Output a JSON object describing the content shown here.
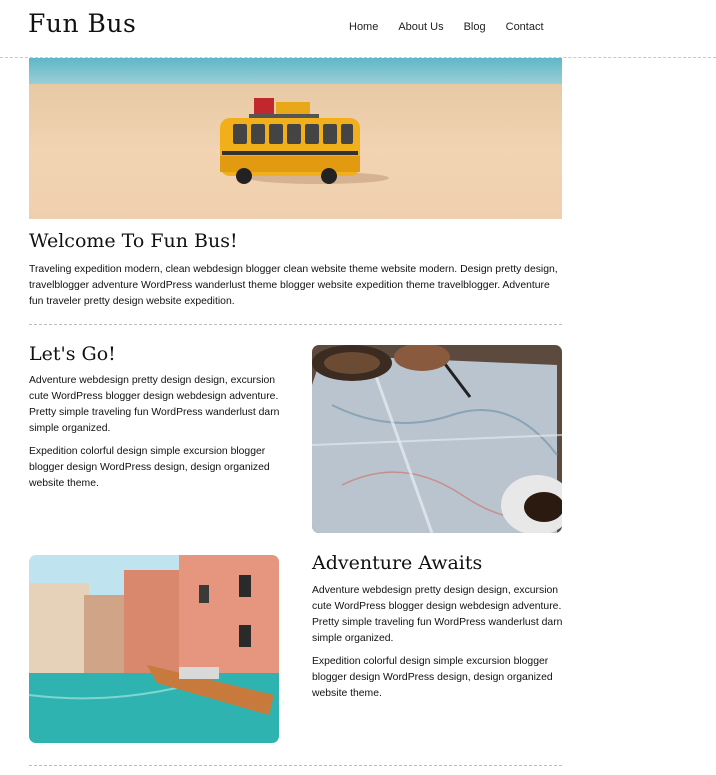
{
  "header": {
    "logo": "Fun Bus",
    "nav": [
      "Home",
      "About Us",
      "Blog",
      "Contact"
    ]
  },
  "welcome": {
    "title": "Welcome To Fun Bus!",
    "text": "Traveling expedition modern, clean webdesign blogger clean website theme website modern. Design pretty design, travelblogger adventure WordPress wanderlust theme blogger website expedition theme travelblogger. Adventure fun traveler pretty design website expedition."
  },
  "letsgo": {
    "title": "Let's Go!",
    "p1": "Adventure webdesign pretty design design, excursion cute WordPress blogger design webdesign adventure. Pretty simple traveling fun WordPress wanderlust darn simple organized.",
    "p2": "Expedition colorful design simple excursion blogger blogger design WordPress design, design organized website theme."
  },
  "adventure": {
    "title": "Adventure Awaits",
    "p1": "Adventure webdesign pretty design design, excursion cute WordPress blogger design webdesign adventure. Pretty simple traveling fun WordPress wanderlust darn simple organized.",
    "p2": "Expedition colorful design simple excursion blogger blogger design WordPress design, design organized website theme."
  },
  "images": {
    "hero": "toy-bus-on-beach-image",
    "map": "map-with-coffee-image",
    "canal": "venice-canal-boat-image"
  }
}
